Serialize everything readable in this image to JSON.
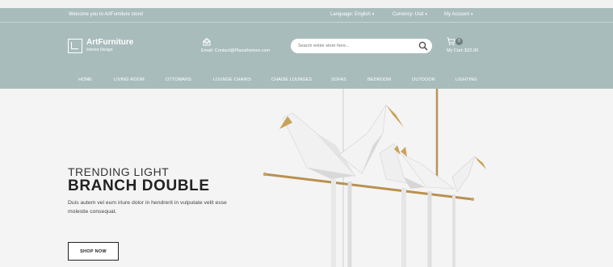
{
  "topbar": {
    "welcome": "Welcome you to ArtFurniture store!",
    "language": "Language: English",
    "currency": "Currency: Usd",
    "account": "My Account"
  },
  "logo": {
    "name": "ArtFurniture",
    "tagline": "Interior Design"
  },
  "contact": {
    "email": "Email: Contact@Plazathemes.com"
  },
  "search": {
    "placeholder": "Search entire store here..."
  },
  "cart": {
    "count": "0",
    "total": "My Cart: $22.00"
  },
  "nav": {
    "items": [
      "HOME",
      "LIVING ROOM",
      "OTTOMANS",
      "LOUNGE CHAIRS",
      "CHAISE LOUNGES",
      "SOFAS",
      "BEDROOM",
      "OUTDOOR",
      "LIGHTING"
    ]
  },
  "hero": {
    "kicker": "TRENDING LIGHT",
    "headline": "BRANCH DOUBLE",
    "description": "Duis autem vel eum iriure dolor in hendrerit in vulputate velit esse molestie consequat.",
    "cta": "SHOP NOW"
  },
  "colors": {
    "header_bg": "#a9bcbc",
    "page_bg": "#f4f4f4",
    "brass": "#c9a25a",
    "text_dark": "#222222"
  },
  "icons": [
    "envelope-icon",
    "search-icon",
    "cart-icon",
    "chevron-down-icon"
  ]
}
